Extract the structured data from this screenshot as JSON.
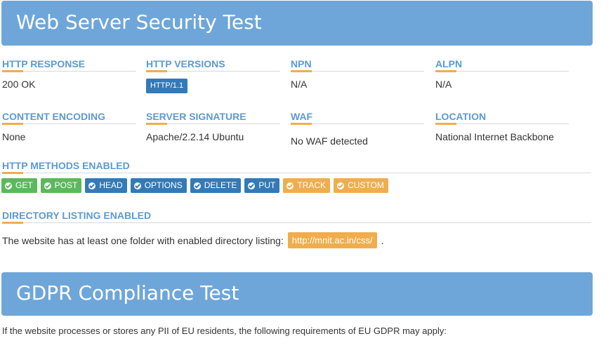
{
  "header": {
    "title": "Web Server Security Test"
  },
  "http_response": {
    "label": "HTTP RESPONSE",
    "value": "200 OK"
  },
  "http_versions": {
    "label": "HTTP VERSIONS",
    "value": "HTTP/1.1"
  },
  "npn": {
    "label": "NPN",
    "value": "N/A"
  },
  "alpn": {
    "label": "ALPN",
    "value": "N/A"
  },
  "content_encoding": {
    "label": "CONTENT ENCODING",
    "value": "None"
  },
  "server_signature": {
    "label": "SERVER SIGNATURE",
    "value": "Apache/2.2.14 Ubuntu"
  },
  "waf": {
    "label": "WAF",
    "value": "No WAF detected"
  },
  "location": {
    "label": "LOCATION",
    "value": "National Internet Backbone"
  },
  "methods": {
    "label": "HTTP METHODS ENABLED",
    "items": [
      {
        "name": "GET",
        "status": "green"
      },
      {
        "name": "POST",
        "status": "green"
      },
      {
        "name": "HEAD",
        "status": "blue"
      },
      {
        "name": "OPTIONS",
        "status": "blue"
      },
      {
        "name": "DELETE",
        "status": "blue"
      },
      {
        "name": "PUT",
        "status": "blue"
      },
      {
        "name": "TRACK",
        "status": "orange"
      },
      {
        "name": "CUSTOM",
        "status": "orange"
      }
    ]
  },
  "directory": {
    "label": "DIRECTORY LISTING ENABLED",
    "text": "The website has at least one folder with enabled directory listing:",
    "url": "http://mnit.ac.in/css/",
    "suffix": "."
  },
  "gdpr": {
    "title": "GDPR Compliance Test",
    "text": "If the website processes or stores any PII of EU residents, the following requirements of EU GDPR may apply:"
  },
  "colors": {
    "banner": "#6fa6d9",
    "label": "#5c9ad2",
    "underline_accent": "#f0ad4e",
    "green": "#5cb85c",
    "blue": "#337ab7",
    "orange": "#f0ad4e"
  }
}
